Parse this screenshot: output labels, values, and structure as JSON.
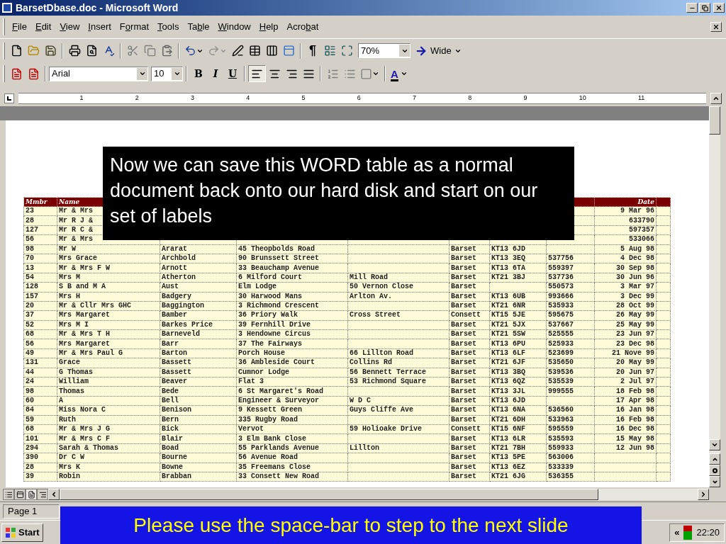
{
  "window": {
    "title": "BarsetDbase.doc - Microsoft Word"
  },
  "menu": [
    {
      "key": "F",
      "post": "ile"
    },
    {
      "key": "E",
      "post": "dit"
    },
    {
      "key": "V",
      "post": "iew"
    },
    {
      "key": "I",
      "post": "nsert"
    },
    {
      "pre": "F",
      "key": "o",
      "post": "rmat"
    },
    {
      "key": "T",
      "post": "ools"
    },
    {
      "pre": "Ta",
      "key": "b",
      "post": "le"
    },
    {
      "key": "W",
      "post": "indow"
    },
    {
      "key": "H",
      "post": "elp"
    },
    {
      "pre": "Acro",
      "key": "b",
      "post": "at"
    }
  ],
  "standard_toolbar": {
    "pilcrow": "¶",
    "zoom": "70%",
    "wide": "Wide"
  },
  "formatting_toolbar": {
    "font": "Arial",
    "size": "10",
    "bold": "B",
    "italic": "I",
    "underline": "U",
    "font_color": "A"
  },
  "ruler_marks": [
    "1",
    "2",
    "3",
    "4",
    "5",
    "6",
    "7",
    "8",
    "9",
    "10",
    "11"
  ],
  "table": {
    "columns": [
      "Mmbr",
      "Name",
      "",
      "",
      "",
      "",
      "",
      "",
      "Date"
    ],
    "rows": [
      {
        "mmbr": "23",
        "name": "Mr & Mrs",
        "date": "9 Mar 96"
      },
      {
        "mmbr": "28",
        "name": "Mr R J &",
        "date": "633790"
      },
      {
        "mmbr": "127",
        "name": "Mr R C &",
        "date": "597357"
      },
      {
        "mmbr": "56",
        "name": "Mr & Mrs",
        "date": "533066"
      },
      {
        "mmbr": "98",
        "name": "Mr W",
        "column_3": "Ararat",
        "column_4": "45 Theopbolds Road",
        "column_6": "Barset",
        "column_7": "KT13 6JD",
        "date": "5 Aug 98"
      },
      {
        "mmbr": "70",
        "name": "Mrs Grace",
        "column_3": "Archbold",
        "column_4": "90 Brunssett Street",
        "column_6": "Barset",
        "column_7": "KT13 3EQ",
        "column_8": "537756",
        "date": "4 Dec 98"
      },
      {
        "mmbr": "13",
        "name": "Mr & Mrs F W",
        "column_3": "Arnott",
        "column_4": "33 Beauchamp Avenue",
        "column_6": "Barset",
        "column_7": "KT13 6TA",
        "column_8": "559397",
        "date": "30 Sep 98"
      },
      {
        "mmbr": "54",
        "name": "Mrs M",
        "column_3": "Atherton",
        "column_4": "6 Milford Court",
        "column_5": "Mill Road",
        "column_6": "Barset",
        "column_7": "KT21 3BJ",
        "column_8": "537736",
        "date": "30 Jun 96"
      },
      {
        "mmbr": "128",
        "name": "S B and M A",
        "column_3": "Aust",
        "column_4": "Elm Lodge",
        "column_5": "50 Vernon Close",
        "column_6": "Barset",
        "column_8": "550573",
        "date": "3 Mar 97"
      },
      {
        "mmbr": "157",
        "name": "Mrs H",
        "column_3": "Badgery",
        "column_4": "30 Harwood Mans",
        "column_5": "Arlton Av.",
        "column_6": "Barset",
        "column_7": "KT13 6UB",
        "column_8": "993666",
        "date": "3 Dec 99"
      },
      {
        "mmbr": "20",
        "name": "Mr & Cllr Mrs GHC",
        "column_3": "Baggington",
        "column_4": "3 Richmond Crescent",
        "column_6": "Barset",
        "column_7": "KT21 6NR",
        "column_8": "535933",
        "date": "28 Oct 99"
      },
      {
        "mmbr": "37",
        "name": "Mrs Margaret",
        "column_3": "Bamber",
        "column_4": "36 Priory Walk",
        "column_5": "Cross Street",
        "column_6": "Consett",
        "column_7": "KT15 5JE",
        "column_8": "595675",
        "date": "26 May 99"
      },
      {
        "mmbr": "52",
        "name": "Mrs M I",
        "column_3": "Barkes Price",
        "column_4": "39 Fernhill Drive",
        "column_6": "Barset",
        "column_7": "KT21 5JX",
        "column_8": "537667",
        "date": "25 May 99"
      },
      {
        "mmbr": "68",
        "name": "Mr & Mrs T H",
        "column_3": "Barneveld",
        "column_4": "3 Hendowne Circus",
        "column_6": "Barset",
        "column_7": "KT21 5SW",
        "column_8": "525555",
        "date": "23 Jun 97"
      },
      {
        "mmbr": "56",
        "name": "Mrs Margaret",
        "column_3": "Barr",
        "column_4": "37 The Fairways",
        "column_6": "Barset",
        "column_7": "KT13 6PU",
        "column_8": "525933",
        "date": "23 Dec 98"
      },
      {
        "mmbr": "49",
        "name": "Mr & Mrs Paul G",
        "column_3": "Barton",
        "column_4": "Porch House",
        "column_5": "66 Lillton Road",
        "column_6": "Barset",
        "column_7": "KT13 6LF",
        "column_8": "523699",
        "date": "21 Nove 99"
      },
      {
        "mmbr": "131",
        "name": "Grace",
        "column_3": "Bassett",
        "column_4": "36 Ambleside Court",
        "column_5": "Collins Rd",
        "column_6": "Barset",
        "column_7": "KT21 6JF",
        "column_8": "535650",
        "date": "20 May 99"
      },
      {
        "mmbr": "44",
        "name": "G Thomas",
        "column_3": "Bassett",
        "column_4": "Cumnor Lodge",
        "column_5": "56 Bennett Terrace",
        "column_6": "Barset",
        "column_7": "KT13 3BQ",
        "column_8": "539536",
        "date": "20 Jun 97"
      },
      {
        "mmbr": "24",
        "name": "William",
        "column_3": "Beaver",
        "column_4": "Flat 3",
        "column_5": "53 Richmond Square",
        "column_6": "Barset",
        "column_7": "KT13 6QZ",
        "column_8": "535539",
        "date": "2 Jul 97"
      },
      {
        "mmbr": "98",
        "name": "Thomas",
        "column_3": "Bede",
        "column_4": "6 St Margaret's Road",
        "column_6": "Barset",
        "column_7": "KT13 3JL",
        "column_8": "999555",
        "date": "18 Feb 98"
      },
      {
        "mmbr": "60",
        "name": "A",
        "column_3": "Bell",
        "column_4": "Engineer & Surveyor",
        "column_5": "W D C",
        "column_6": "Barset",
        "column_7": "KT13 6JD",
        "date": "17 Apr 98"
      },
      {
        "mmbr": "84",
        "name": "Miss Nora C",
        "column_3": "Benison",
        "column_4": "9 Kessett Green",
        "column_5": "Guys Cliffe Ave",
        "column_6": "Barset",
        "column_7": "KT13 6NA",
        "column_8": "536560",
        "date": "16 Jan 98"
      },
      {
        "mmbr": "59",
        "name": "Ruth",
        "column_3": "Bern",
        "column_4": "335 Rugby Road",
        "column_6": "Barset",
        "column_7": "KT21 6DH",
        "column_8": "533963",
        "date": "16 Feb 98"
      },
      {
        "mmbr": "68",
        "name": "Mr & Mrs J G",
        "column_3": "Bick",
        "column_4": "Vervot",
        "column_5": "59 Holioake Drive",
        "column_6": "Consett",
        "column_7": "KT15 6NF",
        "column_8": "595559",
        "date": "16 Dec 98"
      },
      {
        "mmbr": "101",
        "name": "Mr & Mrs C F",
        "column_3": "Blair",
        "column_4": "3 Elm Bank Close",
        "column_6": "Barset",
        "column_7": "KT13 6LR",
        "column_8": "535593",
        "date": "15 May 98"
      },
      {
        "mmbr": "294",
        "name": "Sarah & Thomas",
        "column_3": "Boad",
        "column_4": "55 Parklands Avenue",
        "column_5": "Lillton",
        "column_6": "Barset",
        "column_7": "KT21 7BH",
        "column_8": "559933",
        "date": "12 Jun 98"
      },
      {
        "mmbr": "390",
        "name": "Dr C W",
        "column_3": "Bourne",
        "column_4": "56 Avenue Road",
        "column_6": "Barset",
        "column_7": "KT13 5PE",
        "column_8": "563006"
      },
      {
        "mmbr": "28",
        "name": "Mrs K",
        "column_3": "Bowne",
        "column_4": "35 Freemans Close",
        "column_6": "Barset",
        "column_7": "KT13 6EZ",
        "column_8": "533339"
      },
      {
        "mmbr": "39",
        "name": "Robin",
        "column_3": "Brabban",
        "column_4": "33 Consett New Road",
        "column_6": "Barset",
        "column_7": "KT21 6JG",
        "column_8": "536355"
      }
    ]
  },
  "status_bar": {
    "page": "Page 1"
  },
  "taskbar": {
    "start": "Start",
    "tray_toggle": "«",
    "clock": "22:20"
  },
  "slide_caption": "Now we can save this WORD table as a normal document back onto our hard disk and start on our set of labels",
  "slide_footer": "Please use the space-bar to step to the next slide"
}
